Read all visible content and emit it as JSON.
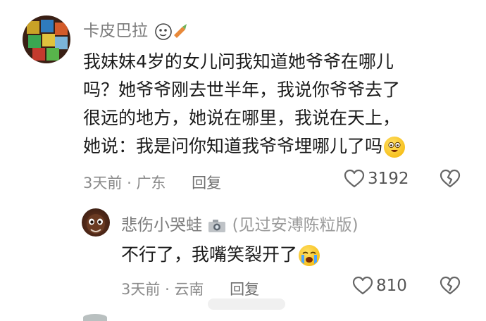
{
  "comments": [
    {
      "author": "卡皮巴拉",
      "text_lines": [
        "我妹妹4岁的女儿问我知道她爷爷在哪儿",
        "吗？她爷爷刚去世半年，我说你爷爷去了",
        "很远的地方，她说在哪里，我说在天上，",
        "她说：我是问你知道我爷爷埋哪儿了吗"
      ],
      "time": "3天前",
      "separator": "·",
      "location": "广东",
      "reply_label": "回复",
      "likes": "3192"
    },
    {
      "author": "悲伤小哭蛙",
      "author_tag": "(见过安溥陈粒版)",
      "text": "不行了，我嘴笑裂开了",
      "time": "3天前",
      "separator": "·",
      "location": "云南",
      "reply_label": "回复",
      "likes": "810"
    }
  ],
  "icons": {
    "like": "heart-outline-icon",
    "dislike": "broken-heart-icon",
    "grin_emoji": "grinning-face-emoji",
    "cry_laugh_emoji": "crying-face-emoji",
    "camera_badge": "camera-icon",
    "name_badge": "cartoon-face-icon"
  },
  "colors": {
    "text": "#1a1a1a",
    "meta": "#8a8a8a",
    "name": "#7d7d7d",
    "icon": "#666666"
  }
}
